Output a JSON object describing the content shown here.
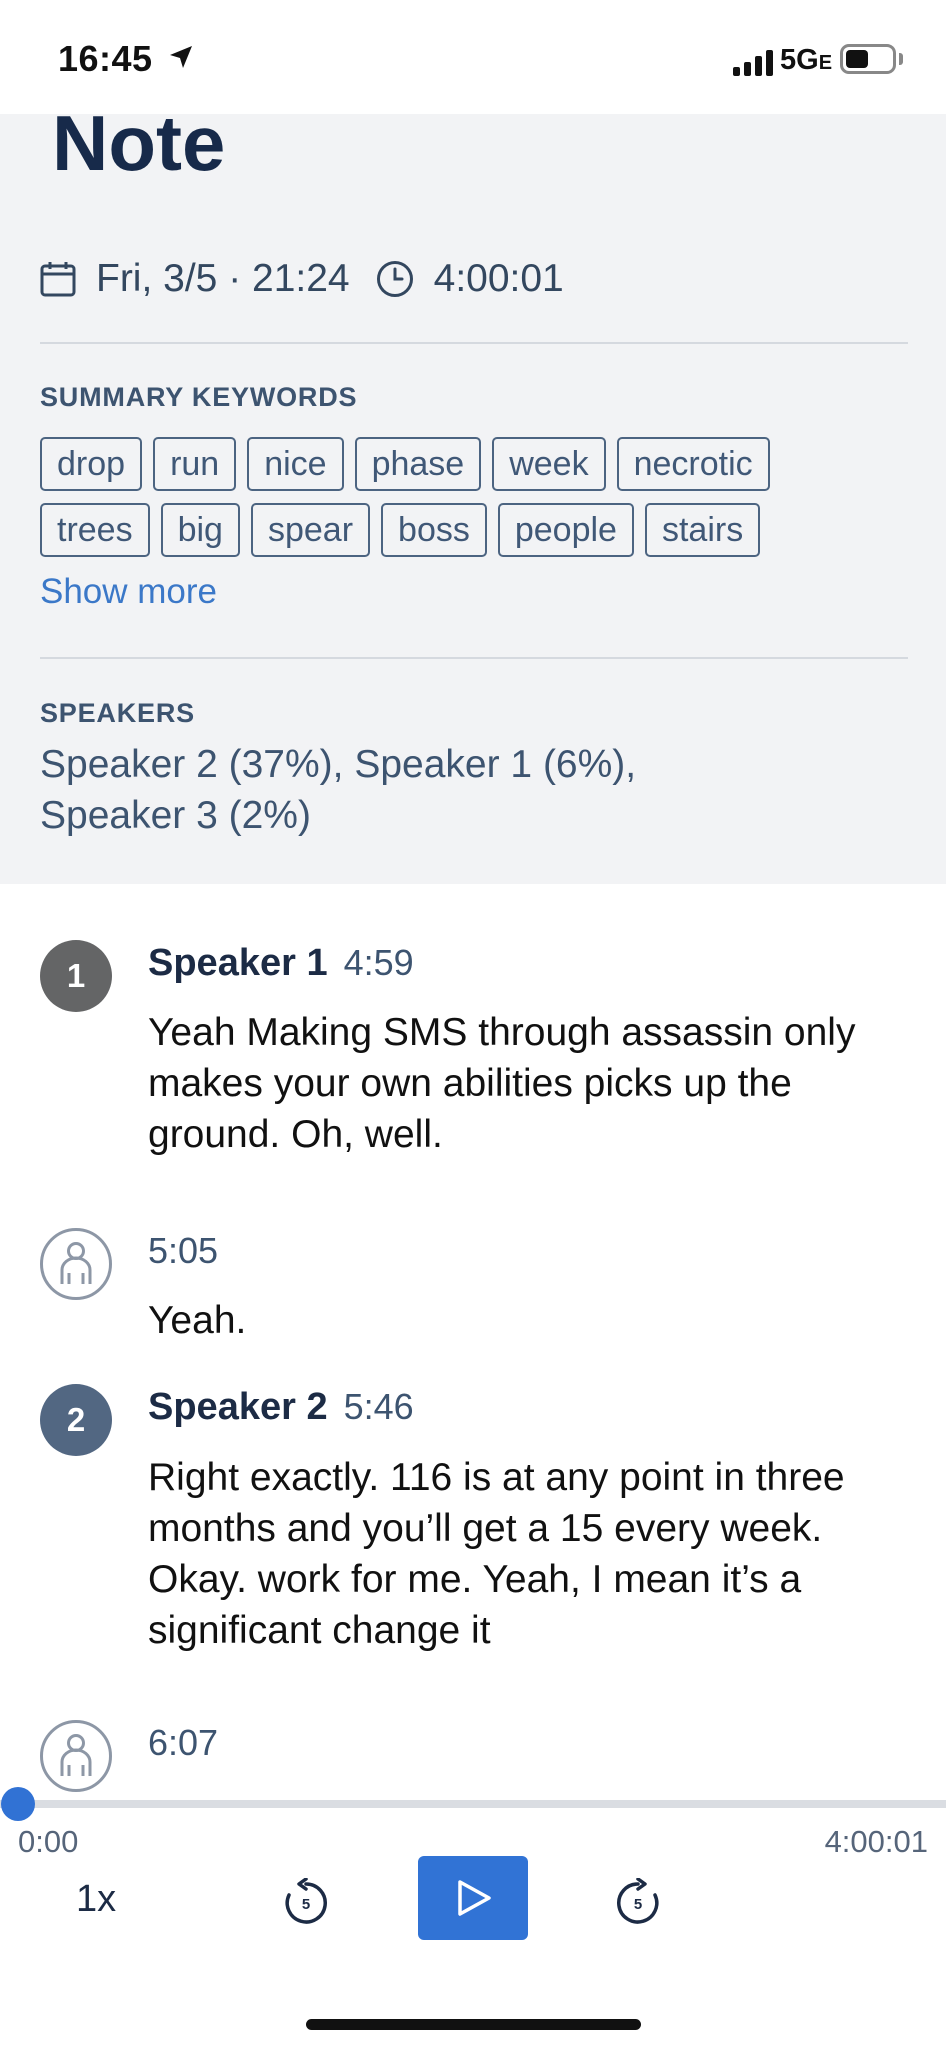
{
  "status_bar": {
    "time": "16:45",
    "network": "5G",
    "network_suffix": "E"
  },
  "note": {
    "title": "Note",
    "date": "Fri, 3/5 · 21:24",
    "duration": "4:00:01"
  },
  "keywords": {
    "label": "SUMMARY KEYWORDS",
    "row1": [
      "drop",
      "run",
      "nice",
      "phase",
      "week",
      "necrotic"
    ],
    "row2": [
      "trees",
      "big",
      "spear",
      "boss",
      "people",
      "stairs"
    ],
    "show_more": "Show more"
  },
  "speakers": {
    "label": "SPEAKERS",
    "line1": "Speaker 2 (37%), Speaker 1 (6%),",
    "line2": "Speaker 3 (2%)"
  },
  "transcript": [
    {
      "avatar": "1",
      "speaker": "Speaker 1",
      "time": "4:59",
      "text": "Yeah Making SMS through assassin only makes your own abilities picks up the ground. Oh, well."
    },
    {
      "avatar": "",
      "speaker": "",
      "time": "5:05",
      "text": "Yeah."
    },
    {
      "avatar": "2",
      "speaker": "Speaker 2",
      "time": "5:46",
      "text": "Right exactly. 116 is at any point in three months and you’ll get a 15 every week. Okay. work for me. Yeah, I mean it’s a significant change it"
    },
    {
      "avatar": "",
      "speaker": "",
      "time": "6:07",
      "text": ""
    }
  ],
  "player": {
    "current": "0:00",
    "total": "4:00:01",
    "speed": "1x",
    "skip_seconds": "5",
    "progress": 0
  },
  "colors": {
    "accent": "#3173d5",
    "header_bg": "#f2f3f5",
    "title": "#172a4a",
    "muted": "#3d5470"
  },
  "icons": {
    "location": "location-arrow-icon",
    "calendar": "calendar-icon",
    "clock": "clock-icon",
    "person": "person-icon",
    "skip_back": "rewind-5-icon",
    "play": "play-icon",
    "skip_forward": "forward-5-icon"
  }
}
